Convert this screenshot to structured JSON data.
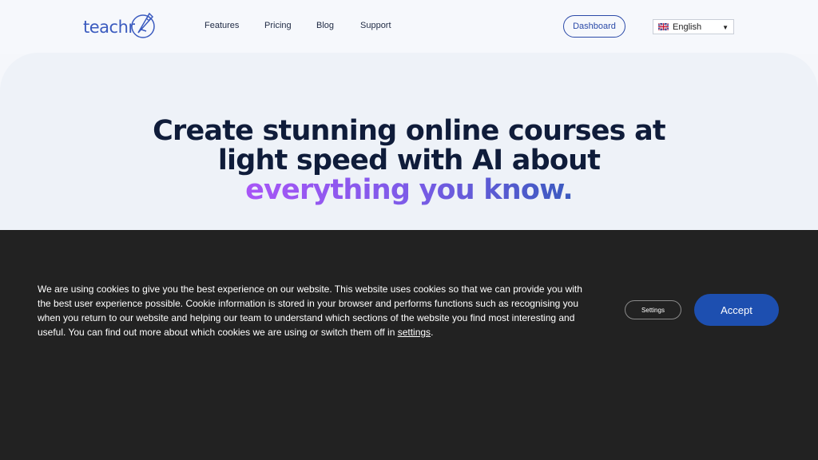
{
  "header": {
    "logo_text": "teachr",
    "nav": [
      "Features",
      "Pricing",
      "Blog",
      "Support"
    ],
    "dashboard_label": "Dashboard",
    "language": {
      "selected": "English",
      "flag": "uk-flag-icon"
    }
  },
  "hero": {
    "title_line1": "Create stunning online courses at",
    "title_line2": "light speed with AI about",
    "title_line3": "everything you know."
  },
  "cookie": {
    "text": "We are using cookies to give you the best experience on our website. This website uses cookies so that we can provide you with the best user experience possible. Cookie information is stored in your browser and performs functions such as recognising you when you return to our website and helping our team to understand which sections of the website you find most interesting and useful. You can find out more about which cookies we are using or switch them off in ",
    "link_text": "settings",
    "suffix": ".",
    "settings_label": "Settings",
    "accept_label": "Accept"
  },
  "colors": {
    "brand": "#3b5bbf",
    "accept": "#1d4fb0",
    "banner_bg": "#222222",
    "gradient_start": "#a855f7"
  }
}
